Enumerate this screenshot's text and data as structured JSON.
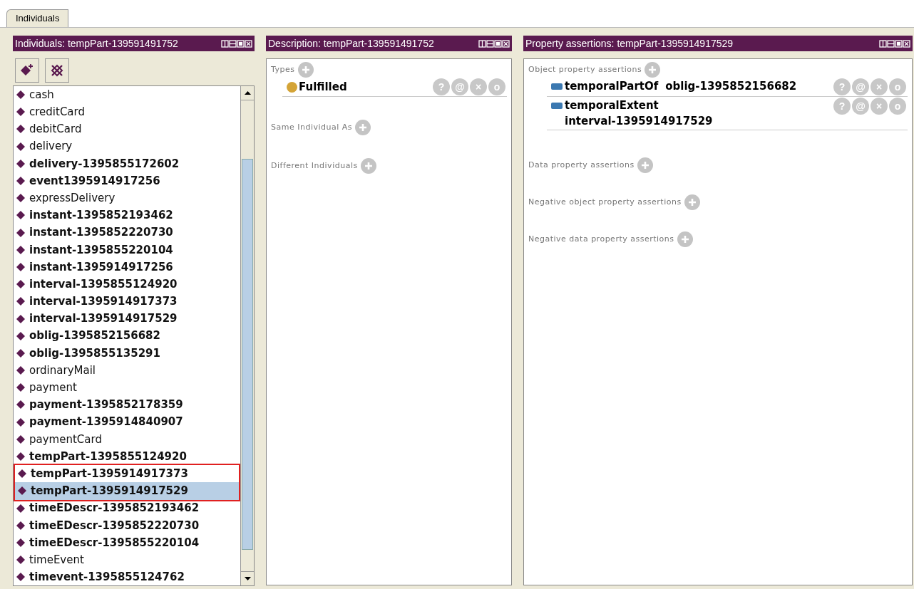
{
  "tabs": [
    {
      "label": "Individuals",
      "selected": true
    }
  ],
  "individuals_panel": {
    "title": "Individuals: tempPart-139591491752",
    "items": [
      {
        "label": "cash",
        "bold": false,
        "selected": false,
        "marked": false
      },
      {
        "label": "creditCard",
        "bold": false,
        "selected": false,
        "marked": false
      },
      {
        "label": "debitCard",
        "bold": false,
        "selected": false,
        "marked": false
      },
      {
        "label": "delivery",
        "bold": false,
        "selected": false,
        "marked": false
      },
      {
        "label": "delivery-1395855172602",
        "bold": true,
        "selected": false,
        "marked": false
      },
      {
        "label": "event1395914917256",
        "bold": true,
        "selected": false,
        "marked": false
      },
      {
        "label": "expressDelivery",
        "bold": false,
        "selected": false,
        "marked": false
      },
      {
        "label": "instant-1395852193462",
        "bold": true,
        "selected": false,
        "marked": false
      },
      {
        "label": "instant-1395852220730",
        "bold": true,
        "selected": false,
        "marked": false
      },
      {
        "label": "instant-1395855220104",
        "bold": true,
        "selected": false,
        "marked": false
      },
      {
        "label": "instant-1395914917256",
        "bold": true,
        "selected": false,
        "marked": false
      },
      {
        "label": "interval-1395855124920",
        "bold": true,
        "selected": false,
        "marked": false
      },
      {
        "label": "interval-1395914917373",
        "bold": true,
        "selected": false,
        "marked": false
      },
      {
        "label": "interval-1395914917529",
        "bold": true,
        "selected": false,
        "marked": false
      },
      {
        "label": "oblig-1395852156682",
        "bold": true,
        "selected": false,
        "marked": false
      },
      {
        "label": "oblig-1395855135291",
        "bold": true,
        "selected": false,
        "marked": false
      },
      {
        "label": "ordinaryMail",
        "bold": false,
        "selected": false,
        "marked": false
      },
      {
        "label": "payment",
        "bold": false,
        "selected": false,
        "marked": false
      },
      {
        "label": "payment-1395852178359",
        "bold": true,
        "selected": false,
        "marked": false
      },
      {
        "label": "payment-1395914840907",
        "bold": true,
        "selected": false,
        "marked": false
      },
      {
        "label": "paymentCard",
        "bold": false,
        "selected": false,
        "marked": false
      },
      {
        "label": "tempPart-1395855124920",
        "bold": true,
        "selected": false,
        "marked": false
      },
      {
        "label": "tempPart-1395914917373",
        "bold": true,
        "selected": false,
        "marked": true
      },
      {
        "label": "tempPart-1395914917529",
        "bold": true,
        "selected": true,
        "marked": true
      },
      {
        "label": "timeEDescr-1395852193462",
        "bold": true,
        "selected": false,
        "marked": false
      },
      {
        "label": "timeEDescr-1395852220730",
        "bold": true,
        "selected": false,
        "marked": false
      },
      {
        "label": "timeEDescr-1395855220104",
        "bold": true,
        "selected": false,
        "marked": false
      },
      {
        "label": "timeEvent",
        "bold": false,
        "selected": false,
        "marked": false
      },
      {
        "label": "timevent-1395855124762",
        "bold": true,
        "selected": false,
        "marked": false
      }
    ]
  },
  "description_panel": {
    "title": "Description: tempPart-139591491752",
    "sections": [
      {
        "label": "Types",
        "items": [
          {
            "label": "Fulfilled",
            "actions": [
              "?",
              "@",
              "×",
              "o"
            ]
          }
        ]
      },
      {
        "label": "Same Individual As"
      },
      {
        "label": "Different Individuals"
      }
    ]
  },
  "property_panel": {
    "title": "Property assertions: tempPart-1395914917529",
    "sections": [
      {
        "label": "Object property assertions",
        "items": [
          {
            "property": "temporalPartOf",
            "value": "oblig-1395852156682",
            "wrapped": false,
            "actions": [
              "?",
              "@",
              "×",
              "o"
            ]
          },
          {
            "property": "temporalExtent",
            "value": "interval-1395914917529",
            "wrapped": true,
            "actions": [
              "?",
              "@",
              "×",
              "o"
            ]
          }
        ]
      },
      {
        "label": "Data property assertions"
      },
      {
        "label": "Negative object property assertions"
      },
      {
        "label": "Negative data property assertions"
      }
    ]
  }
}
